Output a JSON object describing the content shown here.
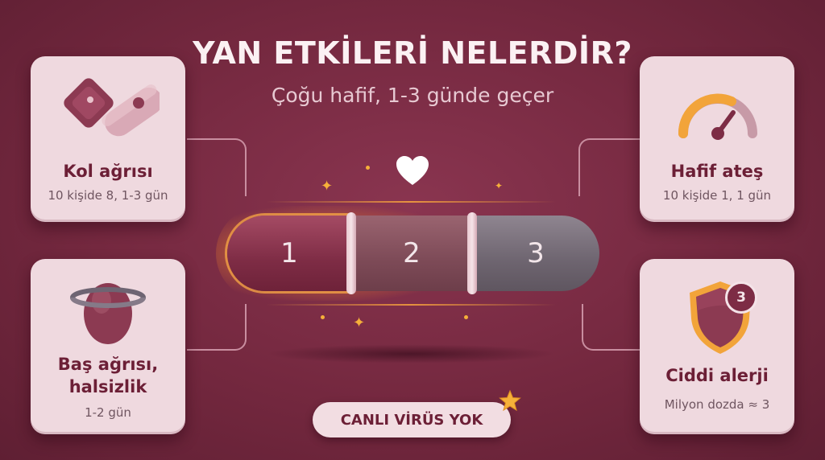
{
  "header": {
    "title": "YAN ETKİLERİ NELERDİR?",
    "subtitle": "Çoğu hafif, 1-3 günde geçer"
  },
  "cards": {
    "arm_pain": {
      "title": "Kol ağrısı",
      "detail": "10 kişide 8, 1-3 gün",
      "icon": "arm-bandage-icon"
    },
    "headache": {
      "title_line1": "Baş ağrısı,",
      "title_line2": "halsizlik",
      "detail": "1-2 gün",
      "icon": "dizzy-head-icon"
    },
    "fever": {
      "title": "Hafif ateş",
      "detail": "10 kişide 1, 1 gün",
      "icon": "gauge-icon"
    },
    "allergy": {
      "title": "Ciddi alerji",
      "detail": "Milyon dozda ≈ 3",
      "icon": "shield-icon",
      "badge": "3"
    }
  },
  "timeline": {
    "segments": [
      "1",
      "2",
      "3"
    ],
    "icon": "heart-icon"
  },
  "footer_badge": {
    "label": "CANLI VİRÜS YOK",
    "icon": "star-icon"
  },
  "colors": {
    "background": "#74283f",
    "card": "#efd9df",
    "accent": "#f6b03a",
    "text_dark": "#6c1f36"
  }
}
